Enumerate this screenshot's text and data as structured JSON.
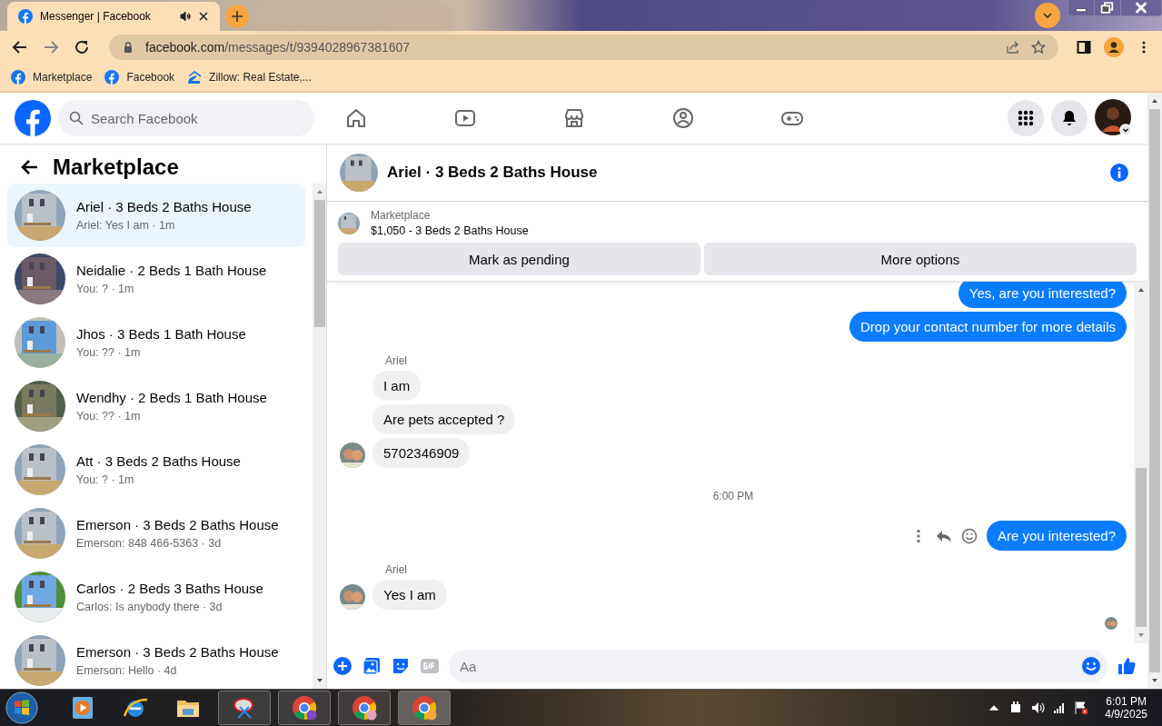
{
  "browser": {
    "tab_title": "Messenger | Facebook",
    "url_host": "facebook.com",
    "url_path": "/messages/t/9394028967381607",
    "bookmarks": [
      {
        "label": "Marketplace",
        "kind": "facebook"
      },
      {
        "label": "Facebook",
        "kind": "facebook"
      },
      {
        "label": "Zillow: Real Estate,...",
        "kind": "zillow"
      }
    ]
  },
  "header": {
    "search_placeholder": "Search Facebook"
  },
  "sidebar": {
    "title": "Marketplace",
    "conversations": [
      {
        "title": "Ariel · 3 Beds 2 Baths House",
        "preview": "Ariel: Yes I am · 1m",
        "selected": true
      },
      {
        "title": "Neidalie · 2 Beds 1 Bath House",
        "preview": "You: ? · 1m",
        "selected": false
      },
      {
        "title": "Jhos · 3 Beds 1 Bath House",
        "preview": "You: ?? · 1m",
        "selected": false
      },
      {
        "title": "Wendhy · 2 Beds 1 Bath House",
        "preview": "You: ?? · 1m",
        "selected": false
      },
      {
        "title": "Att · 3 Beds 2 Baths House",
        "preview": "You: ? · 1m",
        "selected": false
      },
      {
        "title": "Emerson · 3 Beds 2 Baths House",
        "preview": "Emerson: 848 466-5363 · 3d",
        "selected": false
      },
      {
        "title": "Carlos · 2 Beds 3 Baths House",
        "preview": "Carlos: Is anybody there · 3d",
        "selected": false
      },
      {
        "title": "Emerson · 3 Beds 2 Baths House",
        "preview": "Emerson: Hello · 4d",
        "selected": false
      }
    ]
  },
  "chat": {
    "title": "Ariel · 3 Beds 2 Baths House",
    "listing_label": "Marketplace",
    "listing_title": "$1,050 - 3 Beds 2 Baths House",
    "buttons": [
      "Mark as pending",
      "More options"
    ],
    "messages": [
      {
        "kind": "outgoing",
        "text": "Yes, are you interested?",
        "actions": false
      },
      {
        "kind": "outgoing",
        "text": "Drop your contact number for more details",
        "actions": false
      },
      {
        "kind": "incoming",
        "sender": "Ariel",
        "text": "I am",
        "avatar": false
      },
      {
        "kind": "incoming",
        "text": "Are pets accepted ?",
        "avatar": false
      },
      {
        "kind": "incoming",
        "text": "5702346909",
        "avatar": true
      },
      {
        "kind": "timestamp",
        "text": "6:00 PM"
      },
      {
        "kind": "outgoing",
        "text": "Are you interested?",
        "actions": true
      },
      {
        "kind": "incoming",
        "sender": "Ariel",
        "text": "Yes I am",
        "avatar": true
      }
    ],
    "composer_placeholder": "Aa"
  },
  "taskbar": {
    "time": "6:01 PM",
    "date": "4/9/2025"
  }
}
